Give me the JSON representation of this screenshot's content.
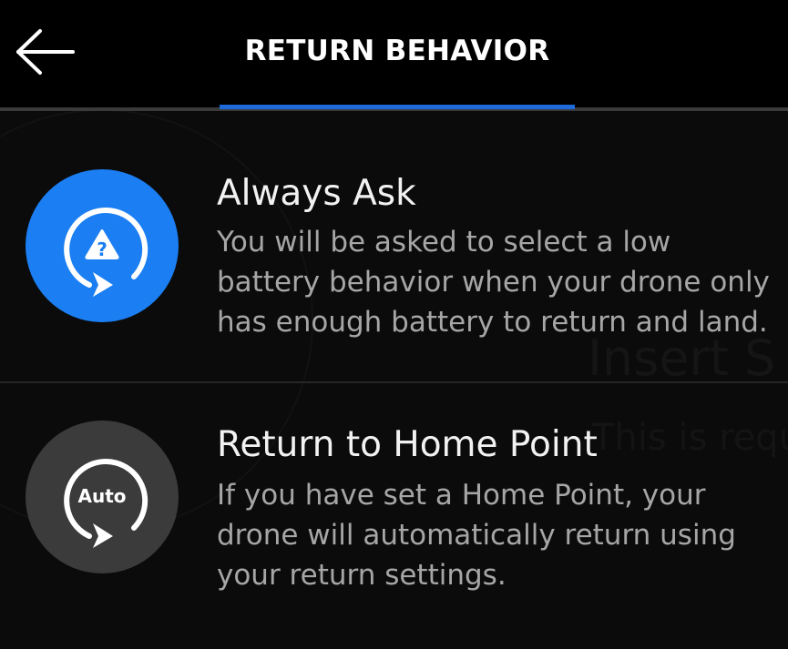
{
  "header": {
    "title": "RETURN BEHAVIOR",
    "back_icon": "arrow-left-icon"
  },
  "background_ghost": {
    "line1": "Insert S",
    "line2": "This is requir"
  },
  "options": [
    {
      "title": "Always Ask",
      "description": "You will be asked to select a low battery behavior when your drone only has enough battery to return and land.",
      "icon": "always-ask-icon",
      "icon_glyph": "?",
      "selected": true,
      "color": "#1b7ef2"
    },
    {
      "title": "Return to Home Point",
      "description": "If you have set a Home Point, your drone will automatically return using your return settings.",
      "icon": "auto-return-icon",
      "icon_label": "Auto",
      "selected": false,
      "color": "#3b3b3b"
    }
  ],
  "colors": {
    "accent": "#1e6ad8",
    "background": "#0b0b0b",
    "header": "#000000"
  }
}
